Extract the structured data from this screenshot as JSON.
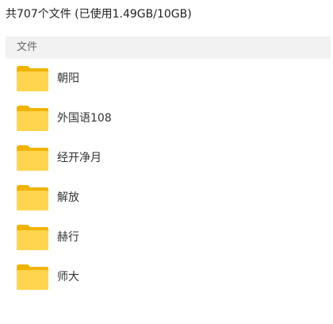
{
  "summary": "共707个文件 (已使用1.49GB/10GB)",
  "section_header": "文件",
  "folder_icon": "folder-icon",
  "colors": {
    "folder_body": "#FFD54F",
    "folder_tab": "#F0B400",
    "header_bg": "#F2F2F2"
  },
  "folders": [
    {
      "name": "朝阳"
    },
    {
      "name": "外国语108"
    },
    {
      "name": "经开净月"
    },
    {
      "name": "解放"
    },
    {
      "name": "赫行"
    },
    {
      "name": "师大"
    }
  ]
}
